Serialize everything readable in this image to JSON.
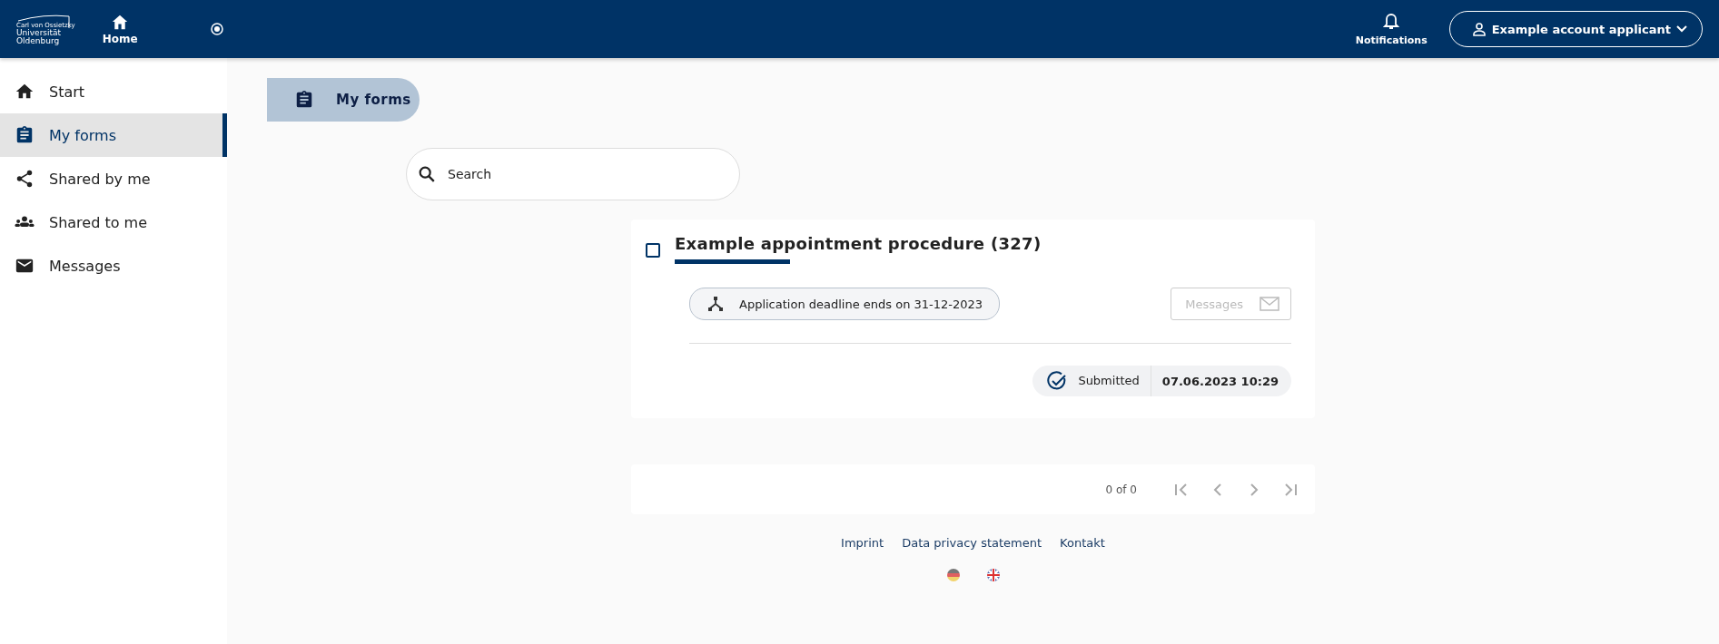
{
  "header": {
    "logo_lines": [
      "Carl von Ossietzky",
      "Universität",
      "Oldenburg"
    ],
    "home": "Home",
    "notifications": "Notifications",
    "account": "Example account applicant"
  },
  "sidebar": {
    "items": [
      {
        "label": "Start",
        "kind": "home",
        "selected": false
      },
      {
        "label": "My forms",
        "kind": "clipboard",
        "selected": true
      },
      {
        "label": "Shared by me",
        "kind": "share",
        "selected": false
      },
      {
        "label": "Shared to me",
        "kind": "group",
        "selected": false
      },
      {
        "label": "Messages",
        "kind": "mail",
        "selected": false
      }
    ]
  },
  "page_title": "My forms",
  "search": {
    "placeholder": "Search"
  },
  "forms": [
    {
      "title": "Example appointment procedure (327)",
      "checked": false,
      "deadline": "Application deadline ends on 31-12-2023",
      "messages_button": {
        "label": "Messages",
        "disabled": true
      },
      "status": "Submitted",
      "date": "07.06.2023 10:29"
    }
  ],
  "pagination": {
    "range": "0 of 0"
  },
  "footer": {
    "links": [
      "Imprint",
      "Data privacy statement",
      "Kontakt"
    ],
    "languages": [
      {
        "kind": "de"
      },
      {
        "kind": "en"
      }
    ]
  }
}
